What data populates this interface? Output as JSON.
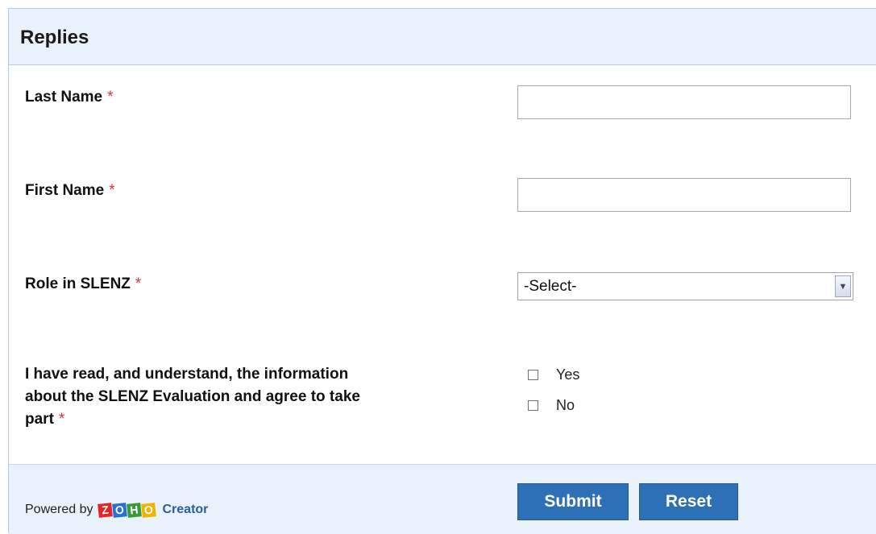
{
  "form": {
    "title": "Replies",
    "required_marker": "*",
    "fields": {
      "last_name": {
        "label": "Last Name",
        "value": ""
      },
      "first_name": {
        "label": "First Name",
        "value": ""
      },
      "role": {
        "label": "Role in SLENZ",
        "selected": "-Select-"
      },
      "consent": {
        "label_lines": [
          "I have read, and understand, the information",
          "about the SLENZ Evaluation and agree to take",
          "part"
        ],
        "options": [
          "Yes",
          "No"
        ]
      }
    }
  },
  "footer": {
    "powered_by": "Powered by",
    "logo_letters": [
      "Z",
      "O",
      "H",
      "O"
    ],
    "logo_colors": [
      "#e42527",
      "#2a6fd6",
      "#3a9a3a",
      "#f2b300"
    ],
    "creator": "Creator",
    "submit_label": "Submit",
    "reset_label": "Reset"
  },
  "icons": {
    "select_arrow": "chevron-down-icon"
  }
}
